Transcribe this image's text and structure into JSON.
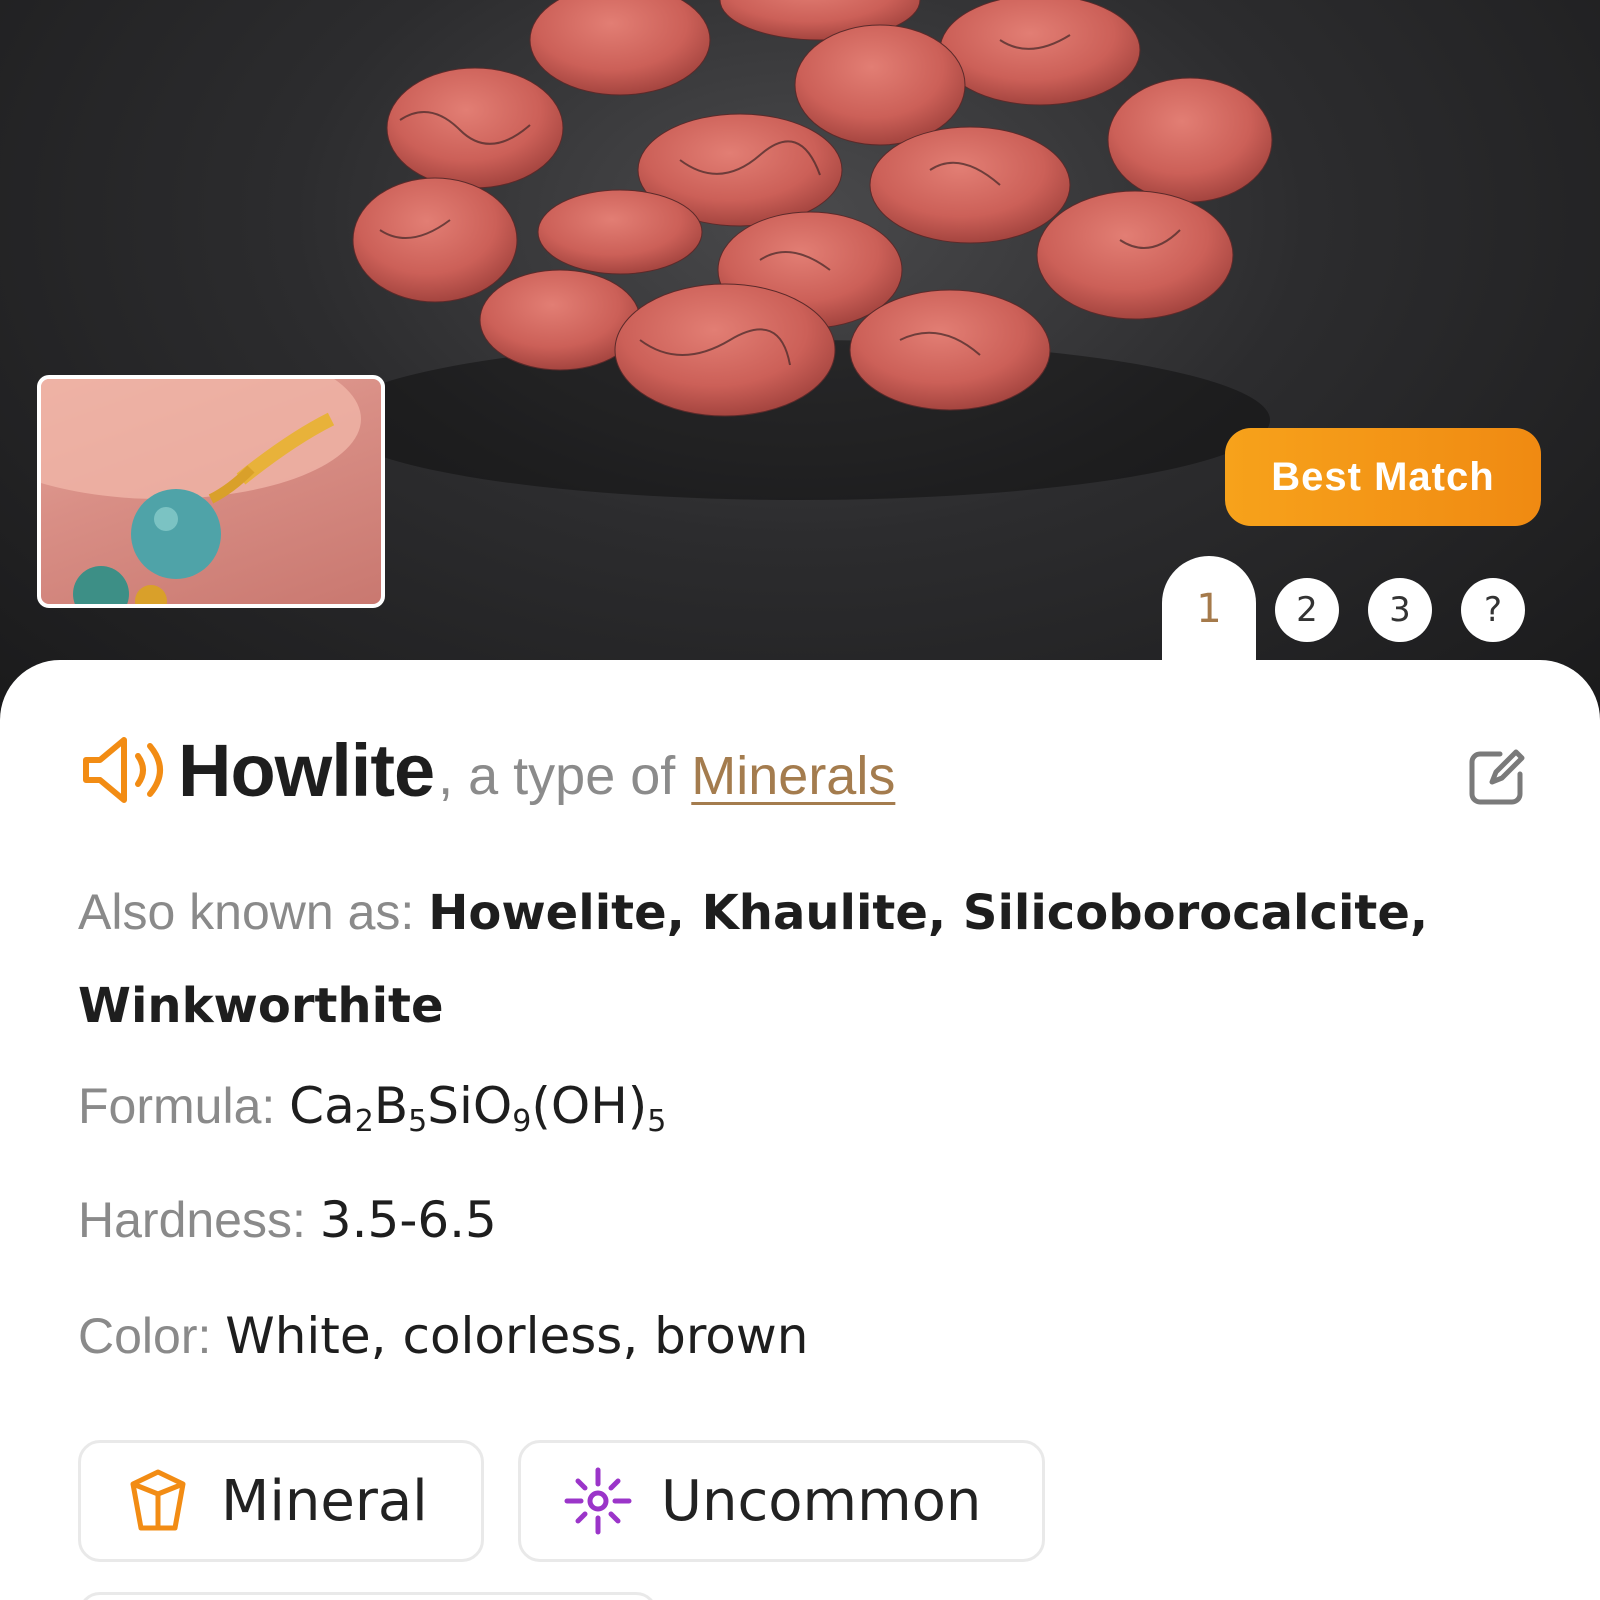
{
  "hero": {
    "best_match_label": "Best Match"
  },
  "tabs": [
    {
      "label": "1",
      "active": true
    },
    {
      "label": "2",
      "active": false
    },
    {
      "label": "3",
      "active": false
    },
    {
      "label": "?",
      "active": false
    }
  ],
  "result": {
    "name": "Howlite",
    "type_prefix": ", a type of",
    "type_link": "Minerals"
  },
  "fields": {
    "aka_label": "Also known as:",
    "aka_value_line1": "Howelite, Khaulite, Silicoborocalcite,",
    "aka_value_line2": "Winkworthite",
    "formula_label": "Formula:",
    "formula_parts": {
      "p1": "Ca",
      "s1": "2",
      "p2": "B",
      "s2": "5",
      "p3": "SiO",
      "s3": "9",
      "p4": "(OH)",
      "s4": "5"
    },
    "hardness_label": "Hardness:",
    "hardness_value": "3.5-6.5",
    "color_label": "Color:",
    "color_value": "White, colorless, brown"
  },
  "chips": [
    {
      "label": "Mineral",
      "icon": "crystal-icon"
    },
    {
      "label": "Uncommon",
      "icon": "sparkle-icon"
    }
  ],
  "colors": {
    "accent_orange": "#f28c14",
    "link_brown": "#a47c4e",
    "chip_purple": "#9b35c9"
  }
}
